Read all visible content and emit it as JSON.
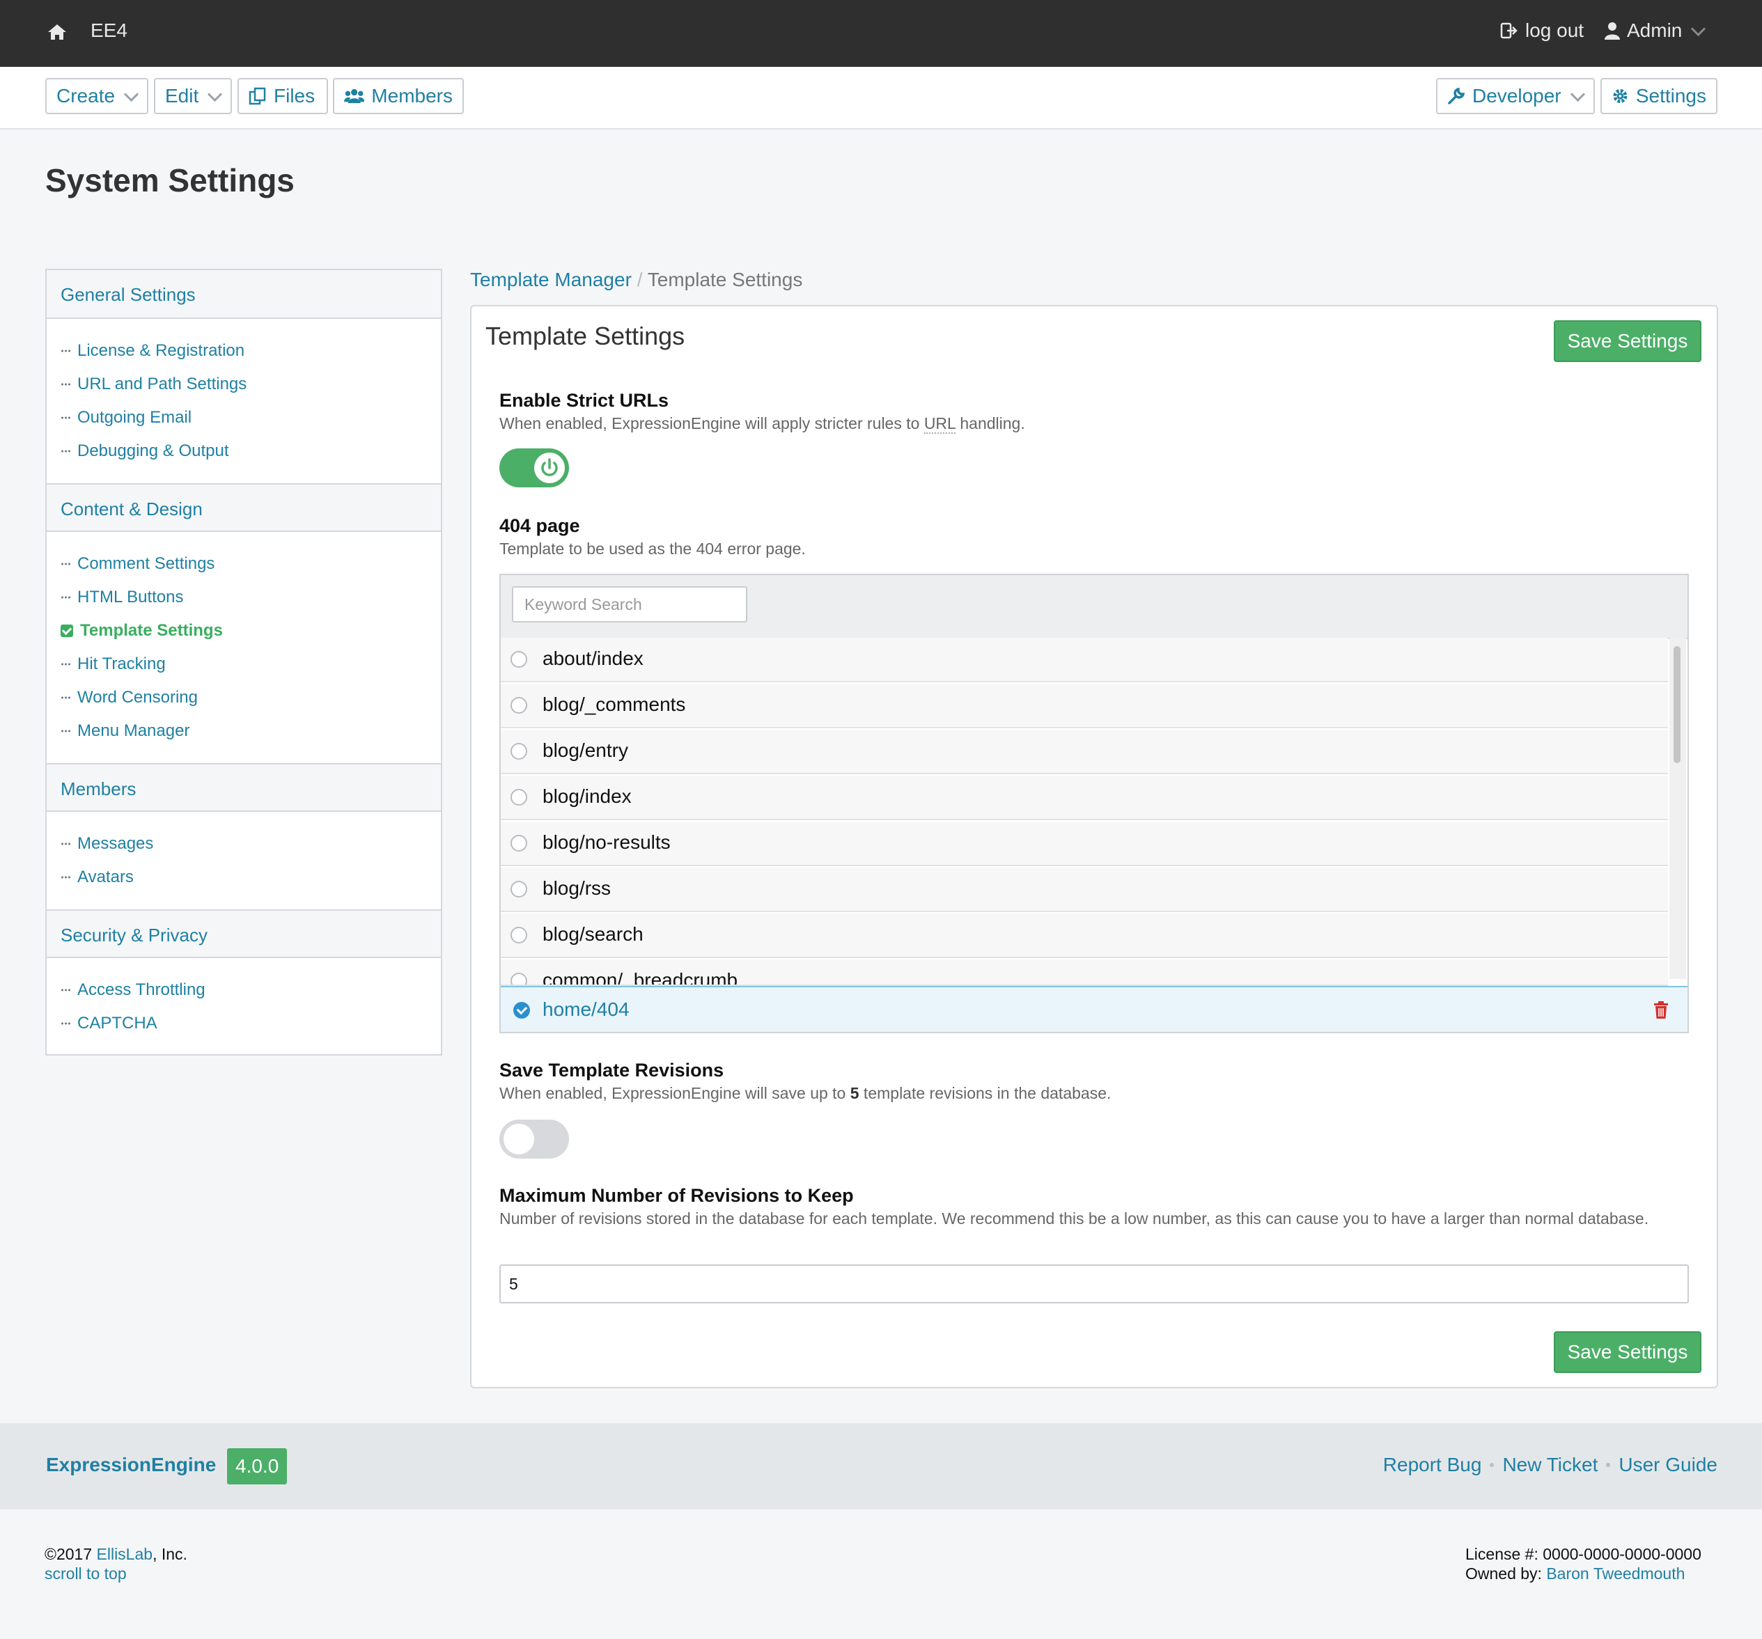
{
  "topbar": {
    "site_name": "EE4",
    "logout_label": "log out",
    "user_label": "Admin"
  },
  "nav": {
    "create": "Create",
    "edit": "Edit",
    "files": "Files",
    "members": "Members",
    "developer": "Developer",
    "settings": "Settings"
  },
  "page_title": "System Settings",
  "sidebar": {
    "sections": [
      {
        "title": "General Settings",
        "items": [
          "License & Registration",
          "URL and Path Settings",
          "Outgoing Email",
          "Debugging & Output"
        ]
      },
      {
        "title": "Content & Design",
        "items": [
          "Comment Settings",
          "HTML Buttons",
          "Template Settings",
          "Hit Tracking",
          "Word Censoring",
          "Menu Manager"
        ]
      },
      {
        "title": "Members",
        "items": [
          "Messages",
          "Avatars"
        ]
      },
      {
        "title": "Security & Privacy",
        "items": [
          "Access Throttling",
          "CAPTCHA"
        ]
      }
    ],
    "active_item": "Template Settings"
  },
  "breadcrumb": {
    "parent": "Template Manager",
    "separator": "/",
    "current": "Template Settings"
  },
  "panel": {
    "title": "Template Settings",
    "save_label": "Save Settings",
    "strict_urls": {
      "title": "Enable Strict URLs",
      "desc_prefix": "When enabled, ExpressionEngine will apply stricter rules to ",
      "desc_abbr": "URL",
      "desc_suffix": " handling.",
      "enabled": true
    },
    "page_404": {
      "title": "404 page",
      "desc": "Template to be used as the 404 error page.",
      "search_placeholder": "Keyword Search",
      "templates": [
        "about/index",
        "blog/_comments",
        "blog/entry",
        "blog/index",
        "blog/no-results",
        "blog/rss",
        "blog/search",
        "common/_breadcrumb"
      ],
      "selected": "home/404"
    },
    "revisions": {
      "title": "Save Template Revisions",
      "desc_prefix": "When enabled, ExpressionEngine will save up to ",
      "desc_bold": "5",
      "desc_suffix": " template revisions in the database.",
      "enabled": false
    },
    "max_revisions": {
      "title": "Maximum Number of Revisions to Keep",
      "desc": "Number of revisions stored in the database for each template. We recommend this be a low number, as this can cause you to have a larger than normal database.",
      "value": "5"
    }
  },
  "footer": {
    "brand": "ExpressionEngine",
    "version": "4.0.0",
    "links": [
      "Report Bug",
      "New Ticket",
      "User Guide"
    ],
    "copyright_prefix": "©2017 ",
    "company": "EllisLab",
    "copyright_suffix": ", Inc.",
    "scroll_top": "scroll to top",
    "license_label": "License #: 0000-0000-0000-0000",
    "owned_by_label": "Owned by: ",
    "owner": "Baron Tweedmouth"
  },
  "colors": {
    "accent": "#1f80a3",
    "success": "#4caf68",
    "topbar": "#2f2f2f",
    "danger": "#d32f2f"
  }
}
